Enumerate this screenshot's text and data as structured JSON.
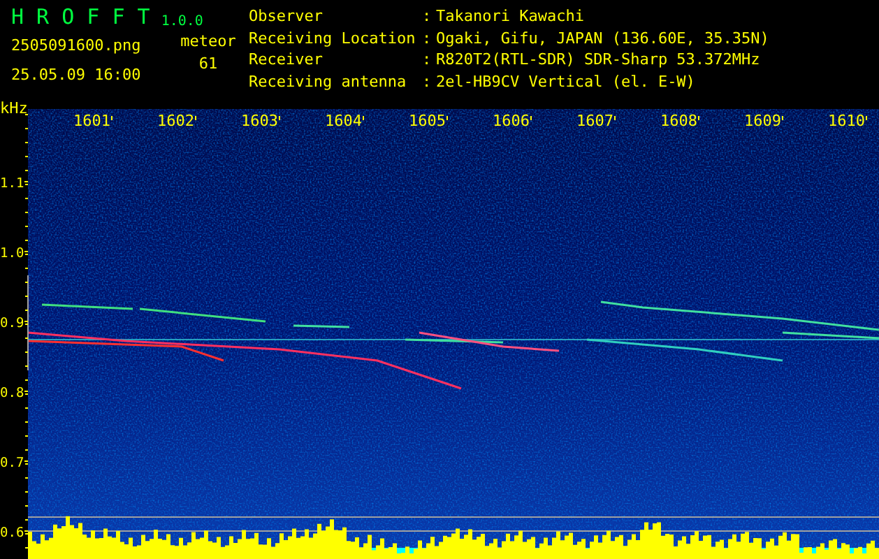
{
  "app": {
    "title": "H R O F F T",
    "version": "1.0.0"
  },
  "file": {
    "name": "2505091600.png",
    "datetime": "25.05.09 16:00"
  },
  "meteor": {
    "label": "meteor",
    "count": "61"
  },
  "info": [
    {
      "label": "Observer",
      "separator": ":",
      "value": "Takanori Kawachi"
    },
    {
      "label": "Receiving Location",
      "separator": ":",
      "value": "Ogaki, Gifu, JAPAN (136.60E, 35.35N)"
    },
    {
      "label": "Receiver",
      "separator": ":",
      "value": "R820T2(RTL-SDR) SDR-Sharp 53.372MHz"
    },
    {
      "label": "Receiving antenna",
      "separator": ":",
      "value": "2el-HB9CV Vertical (el. E-W)"
    }
  ],
  "spectrogram": {
    "y_unit": "kHz",
    "x_labels": [
      "1601",
      "1602",
      "1603",
      "1604",
      "1605",
      "1606",
      "1607",
      "1608",
      "1609",
      "1610"
    ],
    "y_labels": [
      "1.1",
      "1.0",
      "0.9",
      "0.8",
      "0.7",
      "0.6"
    ]
  }
}
